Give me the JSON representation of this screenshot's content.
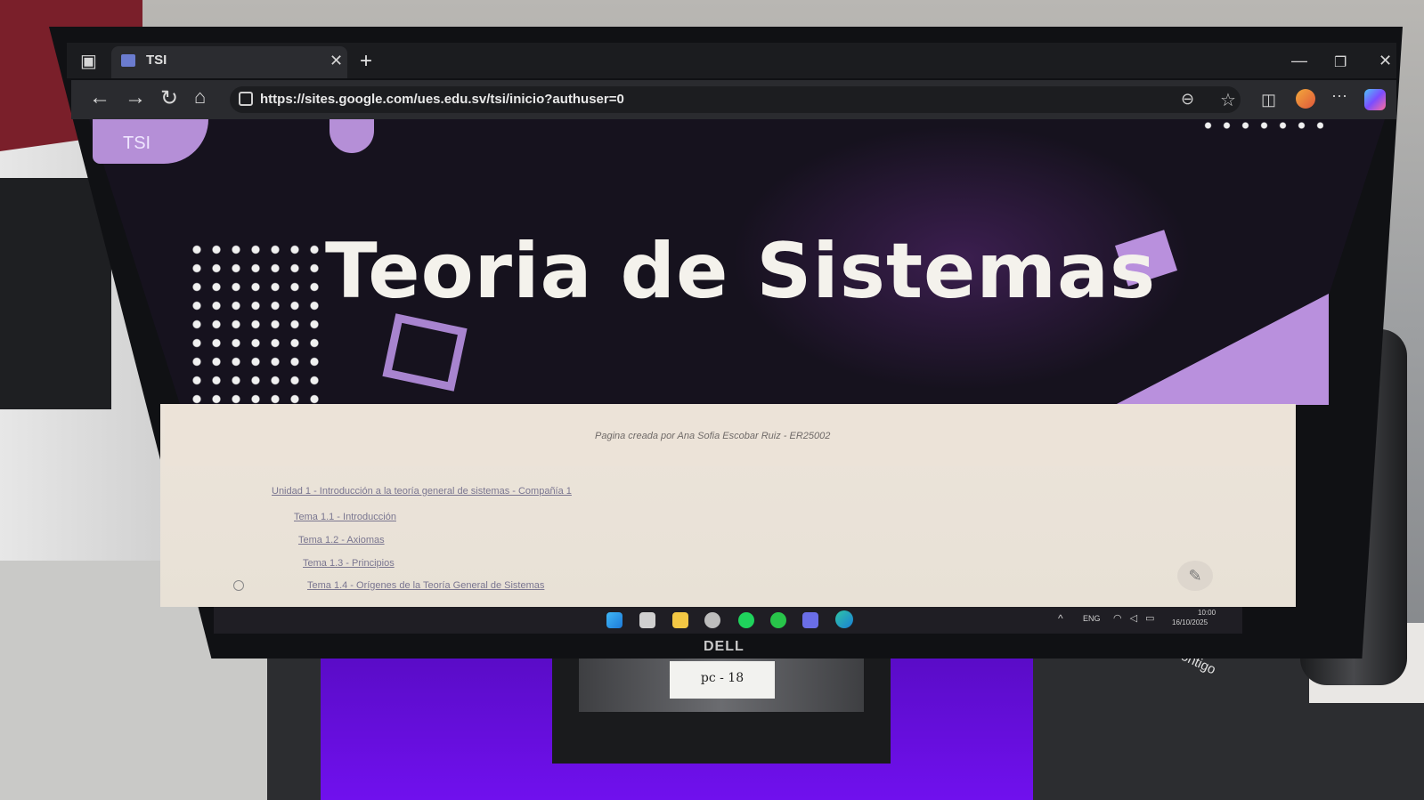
{
  "browser": {
    "tab_title": "TSI",
    "url": "https://sites.google.com/ues.edu.sv/tsi/inicio?authuser=0"
  },
  "site": {
    "logo_text": "TSI",
    "title": "Teoria de Sistemas",
    "credit": "Pagina creada por Ana Sofia Escobar Ruiz - ER25002",
    "nav_links": [
      "Unidad 1 - Introducción a la teoría general de sistemas - Compañía 1",
      "Tema 1.1 - Introducción",
      "Tema 1.2 - Axiomas",
      "Tema 1.3 - Principios",
      "Tema 1.4 - Orígenes de la Teoría General de Sistemas"
    ]
  },
  "taskbar": {
    "language": "ENG",
    "time": "10:00",
    "date": "16/10/2025"
  },
  "scene": {
    "monitor_brand": "DELL",
    "sticker_text": "pc - 18",
    "bottle_brand": "contigo"
  },
  "icons": {
    "nav": [
      "back-arrow-icon",
      "forward-arrow-icon",
      "reload-icon",
      "home-icon"
    ],
    "toolbar": [
      "reader-icon",
      "favorite-star-icon",
      "split-screen-icon",
      "extension-icon",
      "more-icon",
      "copilot-icon"
    ],
    "taskbar": [
      "windows-start-icon",
      "task-view-icon",
      "file-explorer-icon",
      "chrome-icon",
      "spotify-icon",
      "whatsapp-icon",
      "discord-icon",
      "edge-icon"
    ]
  },
  "colors": {
    "banner_bg": "#16121e",
    "accent_purple": "#b58fd7",
    "title_text": "#f4f2ec",
    "content_bg": "#ece4da"
  }
}
